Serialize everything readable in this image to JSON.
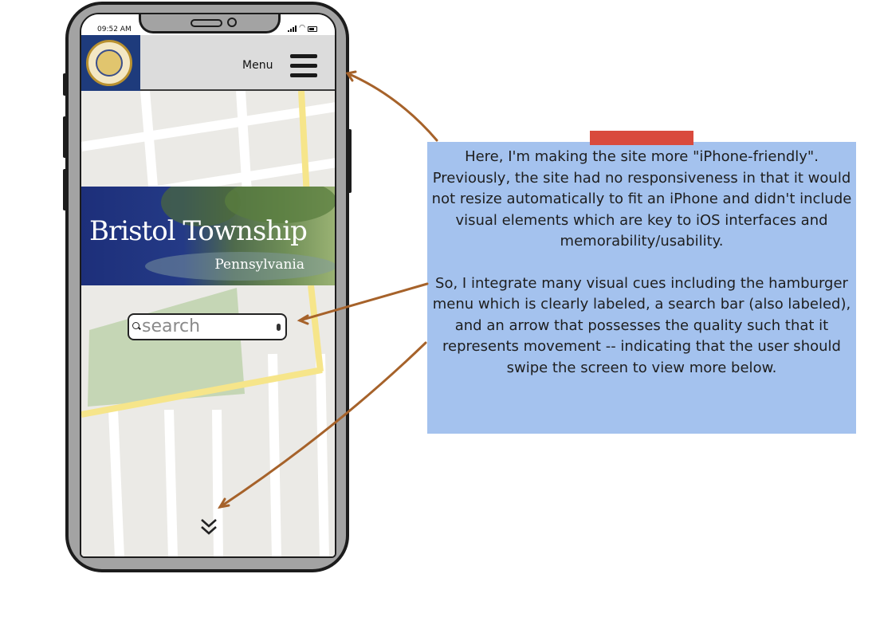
{
  "status_bar": {
    "time": "09:52 AM"
  },
  "header": {
    "menu_label": "Menu"
  },
  "banner": {
    "title": "Bristol Township",
    "subtitle": "Pennsylvania"
  },
  "search": {
    "placeholder": "search"
  },
  "scroll_hint": {
    "glyph": "≫"
  },
  "note": {
    "paragraph1": "Here, I'm making the site more \"iPhone-friendly\". Previously, the site had no responsiveness in that it would not resize automatically to fit an iPhone and didn't include visual elements which are key to iOS interfaces and memorability/usability.",
    "paragraph2": "So, I integrate many visual cues including the hamburger menu which is clearly labeled, a search bar (also labeled), and an arrow that possesses the quality such that it represents movement -- indicating that the user should swipe the screen to view more below."
  },
  "colors": {
    "note_bg": "#a4c2ee",
    "tape": "#d94a3d",
    "arrow": "#a6622a",
    "navbar": "#dcdcdc",
    "logo_bg": "#1e3b7c"
  }
}
